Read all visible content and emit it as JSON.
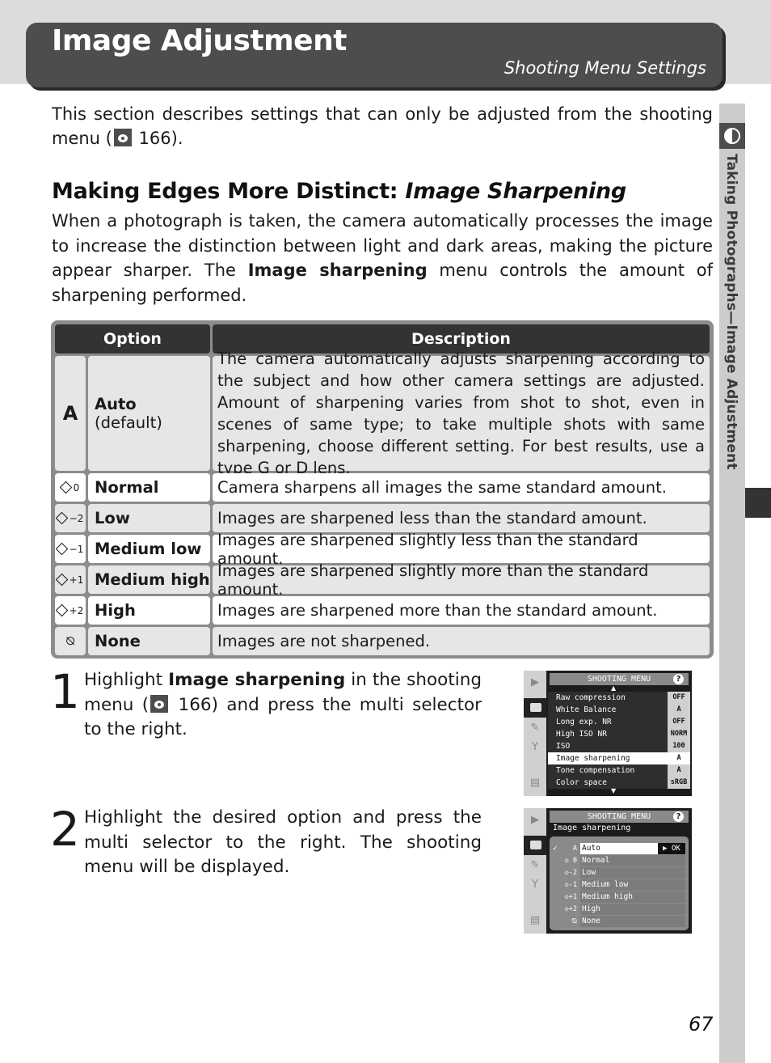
{
  "header": {
    "title": "Image Adjustment",
    "subtitle": "Shooting Menu Settings"
  },
  "side_tab": {
    "icon": "half-circle-icon",
    "label": "Taking Photographs—Image Adjustment"
  },
  "intro": {
    "text_before": "This section describes settings that can only be adjusted from the shooting menu (",
    "ref_icon": "menu-reference-icon",
    "ref_page": " 166).",
    "text_after": ""
  },
  "section": {
    "heading_plain": "Making Edges More Distinct: ",
    "heading_italic": "Image Sharpening",
    "para_before": "When a photograph is taken, the camera automatically processes the image to increase the distinction between light and dark areas, making the picture appear sharper.  The ",
    "para_bold": "Image sharpening",
    "para_after": " menu controls the amount of sharpening performed."
  },
  "table": {
    "headers": {
      "option": "Option",
      "description": "Description"
    },
    "rows": [
      {
        "icon": "A",
        "icon_name": "auto-icon",
        "name": "Auto",
        "note": "(default)",
        "description": "The camera automatically adjusts sharpening according to the subject and how other camera settings are adjusted.  Amount of sharpening varies from shot to shot, even in scenes of same type; to take multiple shots with same sharpening, choose different setting.  For best results, use a type G or D lens."
      },
      {
        "icon": "0",
        "icon_name": "sharpening-0-icon",
        "name": "Normal",
        "description": "Camera sharpens all images the same standard amount."
      },
      {
        "icon": "−2",
        "icon_name": "sharpening-minus2-icon",
        "name": "Low",
        "description": "Images are sharpened less than the standard amount."
      },
      {
        "icon": "−1",
        "icon_name": "sharpening-minus1-icon",
        "name": "Medium low",
        "description": "Images are sharpened slightly less than the standard amount."
      },
      {
        "icon": "+1",
        "icon_name": "sharpening-plus1-icon",
        "name": "Medium high",
        "description": "Images are sharpened slightly more than the standard amount."
      },
      {
        "icon": "+2",
        "icon_name": "sharpening-plus2-icon",
        "name": "High",
        "description": "Images are sharpened more than the standard amount."
      },
      {
        "icon": "⦰",
        "icon_name": "no-sharpening-icon",
        "name": "None",
        "description": "Images are not sharpened."
      }
    ]
  },
  "steps": [
    {
      "number": "1",
      "text_before": "Highlight ",
      "bold": "Image sharpening",
      "text_mid": " in the shooting menu (",
      "ref_page": " 166) and press the multi selector to the right."
    },
    {
      "number": "2",
      "text": "Highlight the desired option and press the multi selector to the right.  The shooting menu will be displayed."
    }
  ],
  "lcd1": {
    "title": "SHOOTING MENU",
    "help": "?",
    "items": [
      {
        "label": "Raw compression",
        "value": "OFF"
      },
      {
        "label": "White Balance",
        "value": "A"
      },
      {
        "label": "Long exp. NR",
        "value": "OFF"
      },
      {
        "label": "High ISO NR",
        "value": "NORM"
      },
      {
        "label": "ISO",
        "value": "100"
      },
      {
        "label": "Image sharpening",
        "value": "A",
        "selected": true
      },
      {
        "label": "Tone compensation",
        "value": "A"
      },
      {
        "label": "Color space",
        "value": "sRGB"
      }
    ]
  },
  "lcd2": {
    "title": "SHOOTING MENU",
    "help": "?",
    "subtitle": "Image sharpening",
    "options": [
      {
        "check": "✓",
        "icon": "A",
        "label": "Auto",
        "ok": "▶ OK",
        "selected": true
      },
      {
        "icon": "◇ 0",
        "label": "Normal"
      },
      {
        "icon": "◇-2",
        "label": "Low"
      },
      {
        "icon": "◇-1",
        "label": "Medium low"
      },
      {
        "icon": "◇+1",
        "label": "Medium high"
      },
      {
        "icon": "◇+2",
        "label": "High"
      },
      {
        "icon": "⦰",
        "label": "None"
      }
    ]
  },
  "page_number": "67"
}
